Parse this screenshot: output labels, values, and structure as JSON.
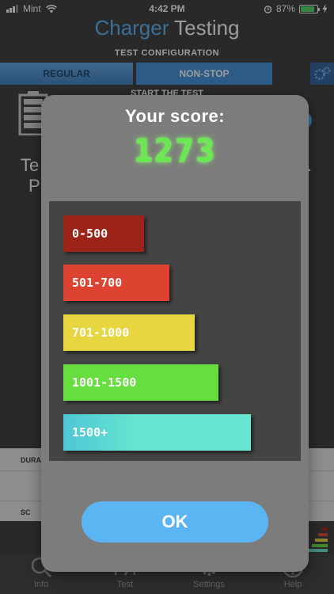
{
  "status_bar": {
    "carrier": "Mint",
    "time": "4:42 PM",
    "battery_percent": "87%"
  },
  "header": {
    "title_part1": "Charger",
    "title_part2": "Testing"
  },
  "config": {
    "label": "TEST CONFIGURATION",
    "tabs": [
      "REGULAR",
      "NON-STOP"
    ]
  },
  "start": {
    "label": "START THE TEST"
  },
  "background": {
    "text_left_1": "Te",
    "text_left_2": "Pl",
    "text_right": ".",
    "table_rows": [
      "DURA",
      "SC"
    ]
  },
  "tab_bar": {
    "items": [
      "Info",
      "Test",
      "Settings",
      "Help"
    ]
  },
  "modal": {
    "heading": "Your score:",
    "score": "1273",
    "ranges": [
      {
        "label": "0-500",
        "color": "#9c2318"
      },
      {
        "label": "501-700",
        "color": "#de4230"
      },
      {
        "label": "701-1000",
        "color": "#e8d640"
      },
      {
        "label": "1001-1500",
        "color": "#67de40"
      },
      {
        "label": "1500+",
        "color": "#66e6d0"
      }
    ],
    "ok_label": "OK"
  },
  "colors": {
    "accent": "#5ab2f5",
    "score_green": "#66ea50",
    "modal_bg": "#7c7c7c",
    "panel_bg": "#444444"
  }
}
